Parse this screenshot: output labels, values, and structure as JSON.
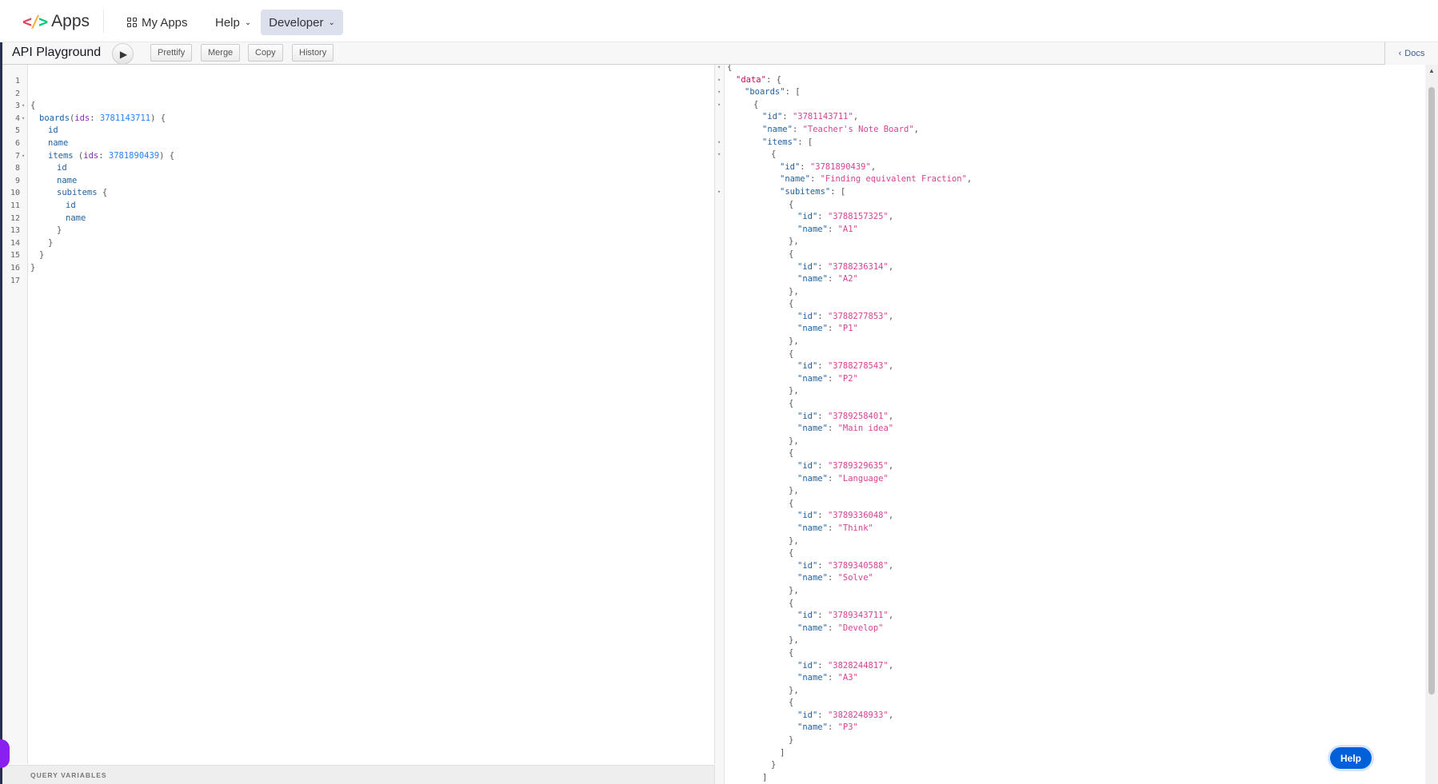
{
  "nav": {
    "logo_text": "Apps",
    "my_apps": "My Apps",
    "help": "Help",
    "developer": "Developer",
    "chevron": "⌄"
  },
  "toolbar": {
    "title": "API Playground",
    "prettify": "Prettify",
    "merge": "Merge",
    "copy": "Copy",
    "history": "History",
    "docs": "Docs"
  },
  "editor": {
    "lines": [
      {
        "n": "1",
        "fold": false,
        "indent": 0,
        "tokens": []
      },
      {
        "n": "2",
        "fold": false,
        "indent": 0,
        "tokens": []
      },
      {
        "n": "3",
        "fold": true,
        "indent": 0,
        "tokens": [
          [
            "p",
            "{"
          ]
        ]
      },
      {
        "n": "4",
        "fold": true,
        "indent": 1,
        "tokens": [
          [
            "f",
            "boards"
          ],
          [
            "p",
            "("
          ],
          [
            "a",
            "ids"
          ],
          [
            "p",
            ": "
          ],
          [
            "n",
            "3781143711"
          ],
          [
            "p",
            ") {"
          ]
        ]
      },
      {
        "n": "5",
        "fold": false,
        "indent": 2,
        "tokens": [
          [
            "f",
            "id"
          ]
        ]
      },
      {
        "n": "6",
        "fold": false,
        "indent": 2,
        "tokens": [
          [
            "f",
            "name"
          ]
        ]
      },
      {
        "n": "7",
        "fold": true,
        "indent": 2,
        "tokens": [
          [
            "f",
            "items"
          ],
          [
            "p",
            " ("
          ],
          [
            "a",
            "ids"
          ],
          [
            "p",
            ": "
          ],
          [
            "n",
            "3781890439"
          ],
          [
            "p",
            ") {"
          ]
        ]
      },
      {
        "n": "8",
        "fold": false,
        "indent": 3,
        "tokens": [
          [
            "f",
            "id"
          ]
        ]
      },
      {
        "n": "9",
        "fold": false,
        "indent": 3,
        "tokens": [
          [
            "f",
            "name"
          ]
        ]
      },
      {
        "n": "10",
        "fold": false,
        "indent": 3,
        "tokens": [
          [
            "f",
            "subitems"
          ],
          [
            "p",
            " {"
          ]
        ]
      },
      {
        "n": "11",
        "fold": false,
        "indent": 4,
        "tokens": [
          [
            "f",
            "id"
          ]
        ]
      },
      {
        "n": "12",
        "fold": false,
        "indent": 4,
        "tokens": [
          [
            "f",
            "name"
          ]
        ]
      },
      {
        "n": "13",
        "fold": false,
        "indent": 3,
        "tokens": [
          [
            "p",
            "}"
          ]
        ]
      },
      {
        "n": "14",
        "fold": false,
        "indent": 2,
        "tokens": [
          [
            "p",
            "}"
          ]
        ]
      },
      {
        "n": "15",
        "fold": false,
        "indent": 1,
        "tokens": [
          [
            "p",
            "}"
          ]
        ]
      },
      {
        "n": "16",
        "fold": false,
        "indent": 0,
        "tokens": [
          [
            "p",
            "}"
          ]
        ]
      },
      {
        "n": "17",
        "fold": false,
        "indent": 0,
        "tokens": []
      }
    ],
    "query_variables": "QUERY VARIABLES"
  },
  "result": {
    "lines": [
      {
        "fold": true,
        "indent": 0,
        "tokens": [
          [
            "p",
            "{"
          ]
        ]
      },
      {
        "fold": true,
        "indent": 1,
        "tokens": [
          [
            "k0",
            "\"data\""
          ],
          [
            "p",
            ": {"
          ]
        ]
      },
      {
        "fold": true,
        "indent": 2,
        "tokens": [
          [
            "k",
            "\"boards\""
          ],
          [
            "p",
            ": ["
          ]
        ]
      },
      {
        "fold": true,
        "indent": 3,
        "tokens": [
          [
            "p",
            "{"
          ]
        ]
      },
      {
        "fold": false,
        "indent": 4,
        "tokens": [
          [
            "k",
            "\"id\""
          ],
          [
            "p",
            ": "
          ],
          [
            "s",
            "\"3781143711\""
          ],
          [
            "p",
            ","
          ]
        ]
      },
      {
        "fold": false,
        "indent": 4,
        "tokens": [
          [
            "k",
            "\"name\""
          ],
          [
            "p",
            ": "
          ],
          [
            "s",
            "\"Teacher's Note Board\""
          ],
          [
            "p",
            ","
          ]
        ]
      },
      {
        "fold": true,
        "indent": 4,
        "tokens": [
          [
            "k",
            "\"items\""
          ],
          [
            "p",
            ": ["
          ]
        ]
      },
      {
        "fold": true,
        "indent": 5,
        "tokens": [
          [
            "p",
            "{"
          ]
        ]
      },
      {
        "fold": false,
        "indent": 6,
        "tokens": [
          [
            "k",
            "\"id\""
          ],
          [
            "p",
            ": "
          ],
          [
            "s",
            "\"3781890439\""
          ],
          [
            "p",
            ","
          ]
        ]
      },
      {
        "fold": false,
        "indent": 6,
        "tokens": [
          [
            "k",
            "\"name\""
          ],
          [
            "p",
            ": "
          ],
          [
            "s",
            "\"Finding equivalent Fraction\""
          ],
          [
            "p",
            ","
          ]
        ]
      },
      {
        "fold": true,
        "indent": 6,
        "tokens": [
          [
            "k",
            "\"subitems\""
          ],
          [
            "p",
            ": ["
          ]
        ]
      }
    ],
    "subitems": [
      {
        "id": "\"3788157325\"",
        "name": "\"A1\""
      },
      {
        "id": "\"3788236314\"",
        "name": "\"A2\""
      },
      {
        "id": "\"3788277853\"",
        "name": "\"P1\""
      },
      {
        "id": "\"3788278543\"",
        "name": "\"P2\""
      },
      {
        "id": "\"3789258401\"",
        "name": "\"Main idea\""
      },
      {
        "id": "\"3789329635\"",
        "name": "\"Language\""
      },
      {
        "id": "\"3789336048\"",
        "name": "\"Think\""
      },
      {
        "id": "\"3789340588\"",
        "name": "\"Solve\""
      },
      {
        "id": "\"3789343711\"",
        "name": "\"Develop\""
      },
      {
        "id": "\"3828244817\"",
        "name": "\"A3\""
      },
      {
        "id": "\"3828248933\"",
        "name": "\"P3\""
      }
    ],
    "closing_lines": [
      {
        "indent": 6,
        "text": "]"
      },
      {
        "indent": 5,
        "text": "}"
      },
      {
        "indent": 4,
        "text": "]"
      }
    ]
  },
  "help_button": "Help",
  "icons": {
    "run": "▶",
    "docs_chevron": "‹",
    "fold": "▾",
    "scroll_up": "▲"
  },
  "colors": {
    "field": "#1f61a0",
    "argument": "#8b2bb9",
    "number": "#2882f9",
    "string": "#d64292",
    "help_button": "#0060d9"
  }
}
